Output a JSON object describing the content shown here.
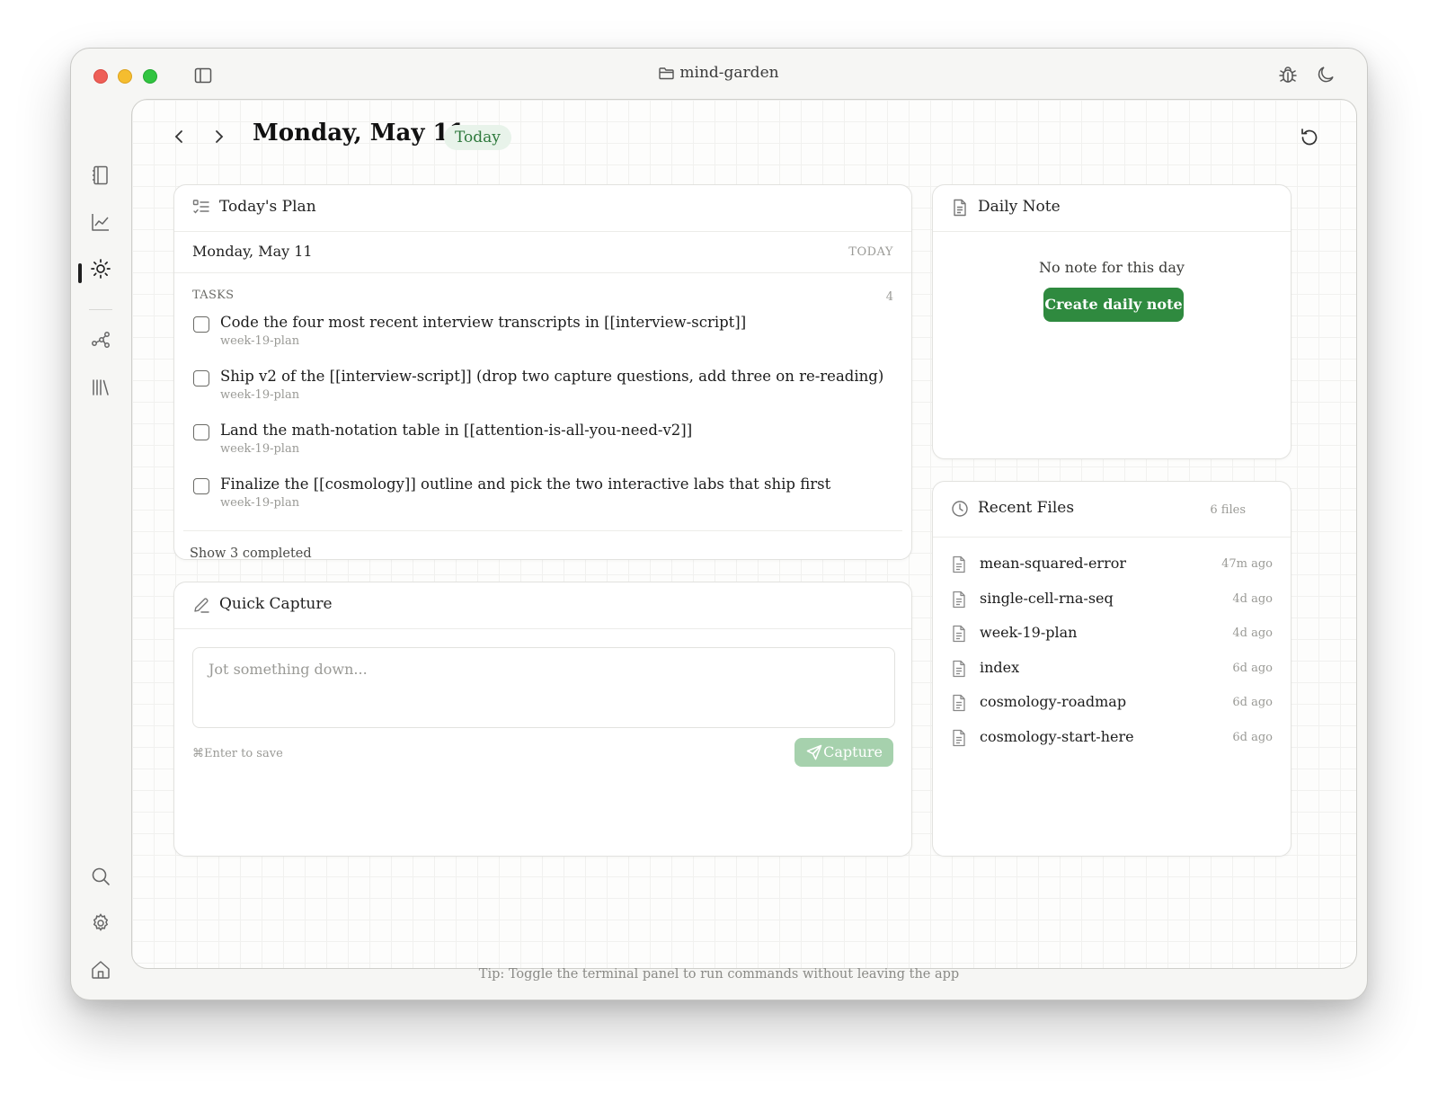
{
  "window": {
    "title": "mind-garden",
    "tip": "Tip: Toggle the terminal panel to run commands without leaving the app"
  },
  "header": {
    "title": "Monday, May 11",
    "badge": "Today"
  },
  "plan": {
    "title": "Today's Plan",
    "date": "Monday, May 11",
    "today_label": "TODAY",
    "tasks_label": "TASKS",
    "tasks_count": "4",
    "tasks": [
      {
        "text": "Code the four most recent interview transcripts in [[interview-script]]",
        "source": "week-19-plan"
      },
      {
        "text": "Ship v2 of the [[interview-script]] (drop two capture questions, add three on re-reading)",
        "source": "week-19-plan"
      },
      {
        "text": "Land the math-notation table in [[attention-is-all-you-need-v2]]",
        "source": "week-19-plan"
      },
      {
        "text": "Finalize the [[cosmology]] outline and pick the two interactive labs that ship first",
        "source": "week-19-plan"
      }
    ],
    "show_completed": "Show 3 completed"
  },
  "capture": {
    "title": "Quick Capture",
    "placeholder": "Jot something down...",
    "hint": "⌘Enter to save",
    "button": "Capture"
  },
  "daily": {
    "title": "Daily Note",
    "empty": "No note for this day",
    "button": "Create daily note"
  },
  "recent": {
    "title": "Recent Files",
    "count": "6 files",
    "files": [
      {
        "name": "mean-squared-error",
        "time": "47m ago"
      },
      {
        "name": "single-cell-rna-seq",
        "time": "4d ago"
      },
      {
        "name": "week-19-plan",
        "time": "4d ago"
      },
      {
        "name": "index",
        "time": "6d ago"
      },
      {
        "name": "cosmology-roadmap",
        "time": "6d ago"
      },
      {
        "name": "cosmology-start-here",
        "time": "6d ago"
      }
    ]
  },
  "colors": {
    "accent": "#2f8a3f",
    "badge_bg": "#e8f3ea",
    "capture_disabled": "#a6d1ad"
  },
  "icons": {
    "titlebar": [
      "sidebar-toggle-icon",
      "folder-icon",
      "bug-icon",
      "moon-icon"
    ],
    "rail": [
      "notebook-icon",
      "chart-line-icon",
      "sun-icon",
      "graph-icon",
      "library-icon",
      "search-icon",
      "gear-icon",
      "home-icon"
    ]
  }
}
